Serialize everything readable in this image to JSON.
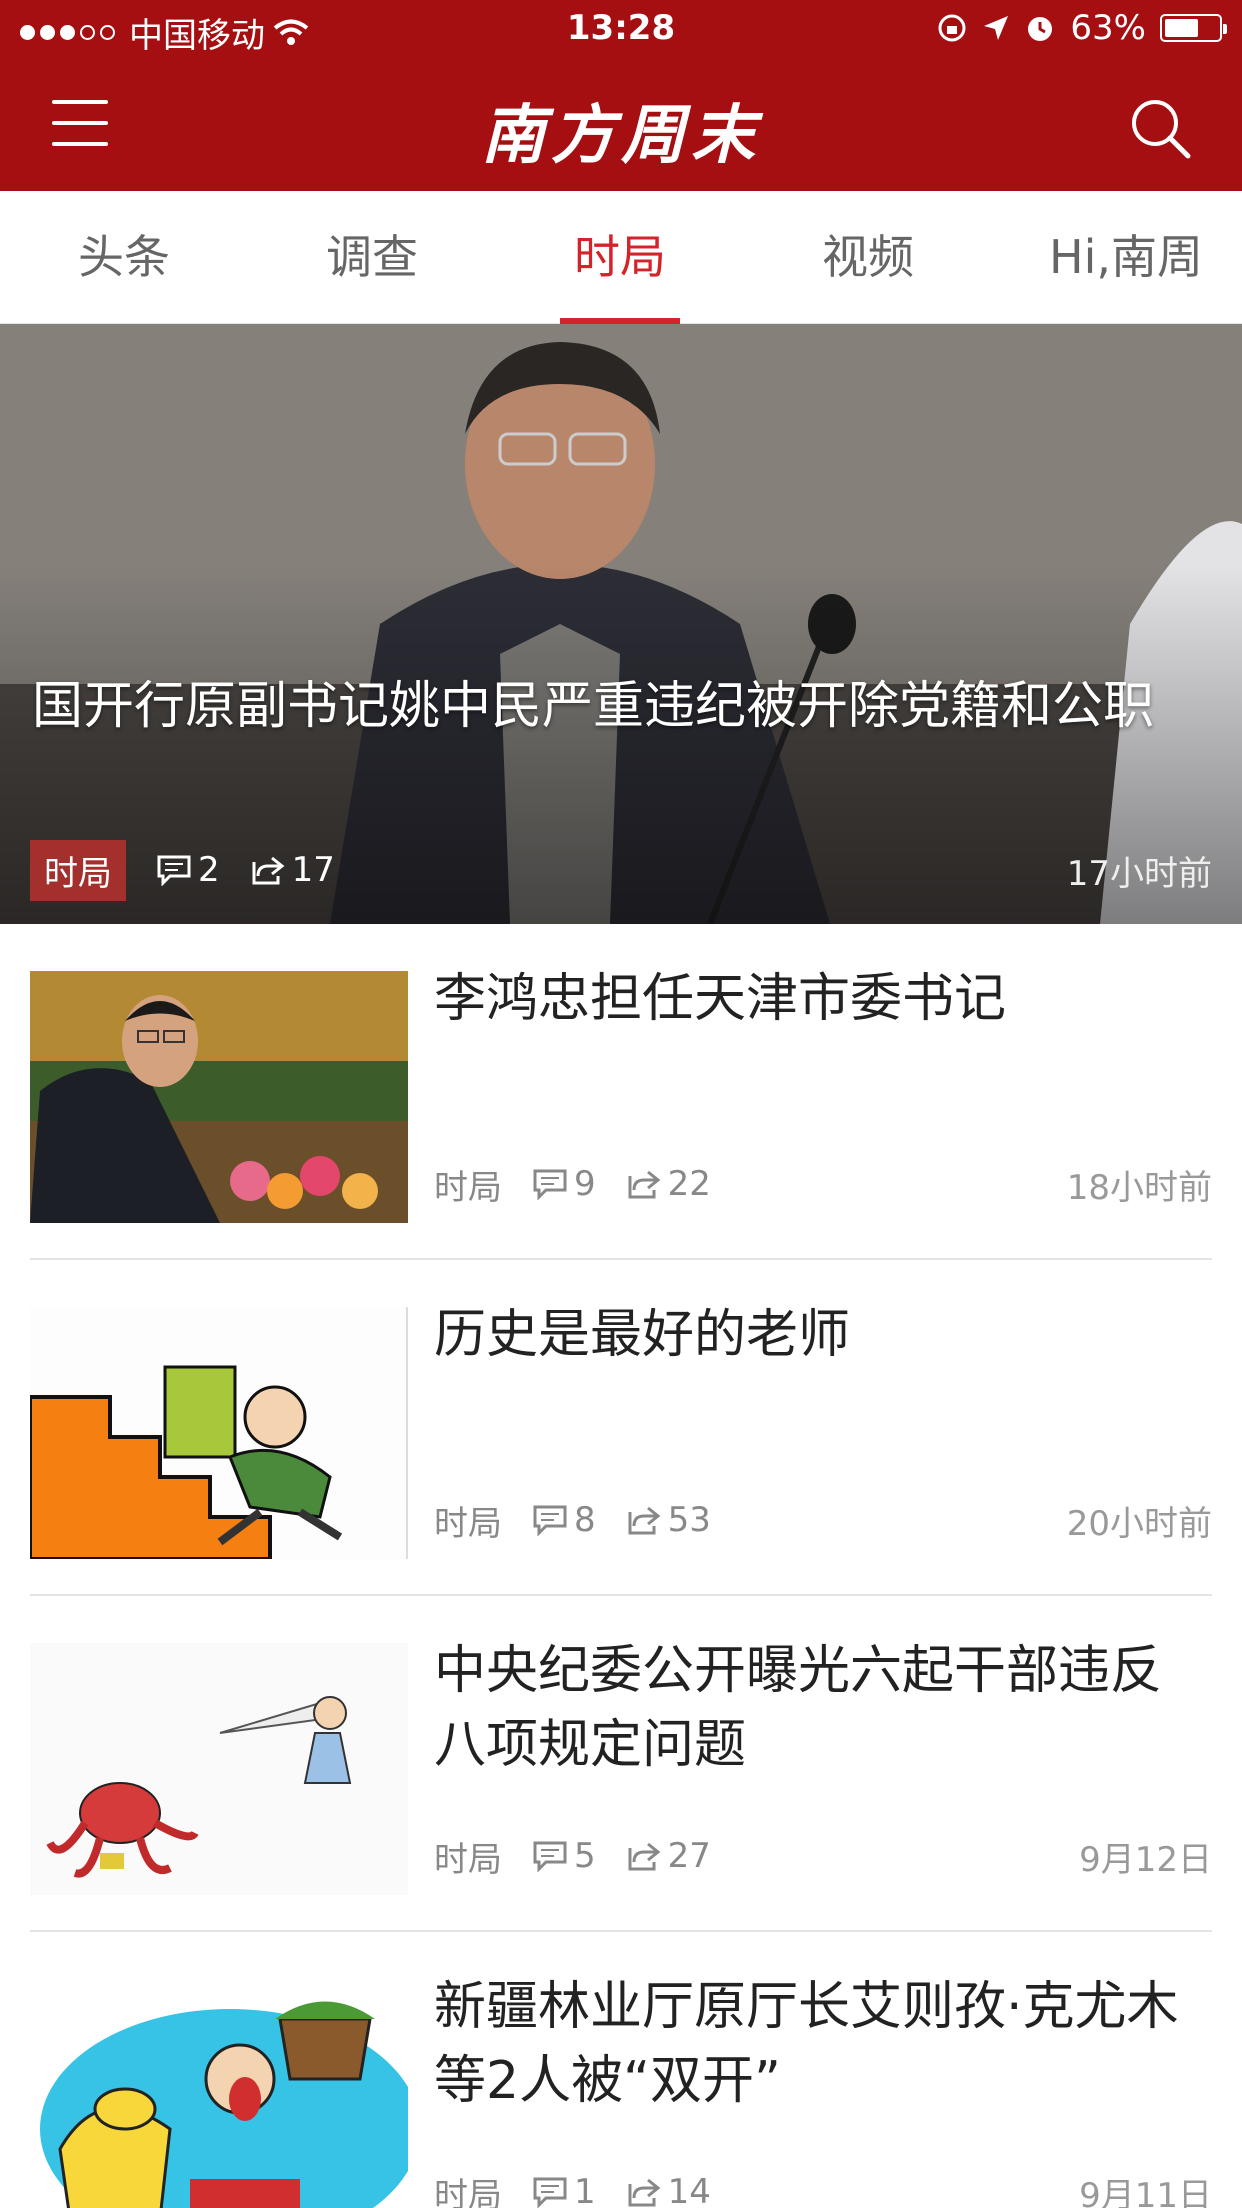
{
  "status_bar": {
    "carrier": "中国移动",
    "time": "13:28",
    "battery": "63%",
    "battery_level": 0.63
  },
  "header": {
    "logo": "南方周末",
    "icons": [
      "menu-icon",
      "search-icon"
    ]
  },
  "tabs": [
    {
      "label": "头条"
    },
    {
      "label": "调查"
    },
    {
      "label": "时局",
      "active": true
    },
    {
      "label": "视频"
    },
    {
      "label": "Hi,南周"
    }
  ],
  "hero": {
    "title": "国开行原副书记姚中民严重违纪被开除党籍和公职",
    "category": "时局",
    "comments": "2",
    "shares": "17",
    "time": "17小时前"
  },
  "articles": [
    {
      "title": "李鸿忠担任天津市委书记",
      "category": "时局",
      "comments": "9",
      "shares": "22",
      "time": "18小时前"
    },
    {
      "title": "历史是最好的老师",
      "category": "时局",
      "comments": "8",
      "shares": "53",
      "time": "20小时前"
    },
    {
      "title": "中央纪委公开曝光六起干部违反八项规定问题",
      "category": "时局",
      "comments": "5",
      "shares": "27",
      "time": "9月12日"
    },
    {
      "title": "新疆林业厅原厅长艾则孜·克尤木等2人被“双开”",
      "category": "时局",
      "comments": "1",
      "shares": "14",
      "time": "9月11日"
    }
  ],
  "colors": {
    "brand": "#a50f12",
    "tab_active": "#d4232a",
    "hero_tag": "#a3302d"
  }
}
